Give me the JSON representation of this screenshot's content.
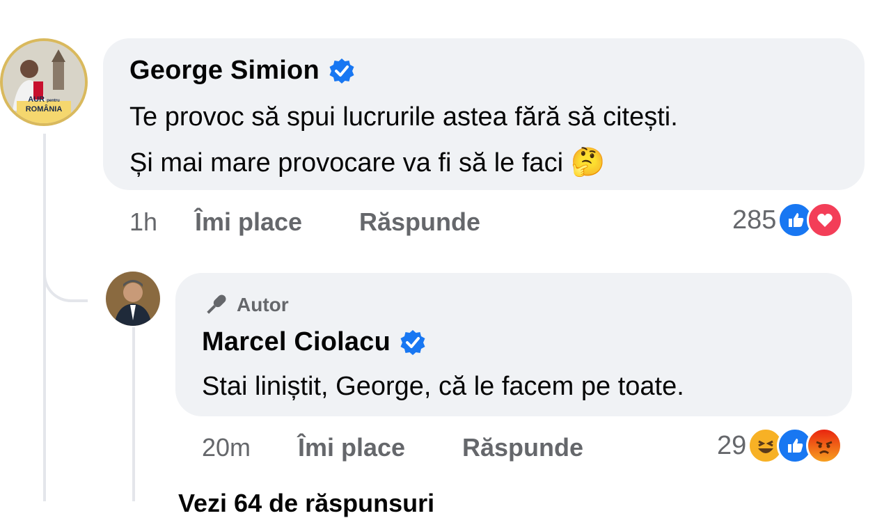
{
  "comment": {
    "author": "George Simion",
    "verified": true,
    "avatar_badge_line1": "AUR",
    "avatar_badge_line1_small": "pentru",
    "avatar_badge_line2": "ROMÂNIA",
    "text_line1": "Te provoc să spui lucrurile astea fără să citești.",
    "text_line2": "Și mai mare provocare va fi să le faci",
    "text_emoji": "🤔",
    "time": "1h",
    "like_label": "Îmi place",
    "reply_label": "Răspunde",
    "reaction_count": "285",
    "reaction_icons": [
      "like-icon",
      "love-icon"
    ]
  },
  "reply": {
    "badge_label": "Autor",
    "badge_icon": "microphone-icon",
    "author": "Marcel Ciolacu",
    "verified": true,
    "text": "Stai liniștit, George, că le facem pe toate.",
    "time": "20m",
    "like_label": "Îmi place",
    "reply_label": "Răspunde",
    "reaction_count": "29",
    "reaction_icons": [
      "haha-icon",
      "like-icon",
      "angry-icon"
    ]
  },
  "more_replies_label": "Vezi 64 de răspunsuri",
  "colors": {
    "bubble": "#f0f2f5",
    "secondary_text": "#65676b",
    "verified_blue": "#1877f2",
    "like_blue": "#1877f2",
    "love_red": "#f33e58",
    "angry_orange": "#e9710f",
    "haha_yellow": "#f7b125"
  }
}
